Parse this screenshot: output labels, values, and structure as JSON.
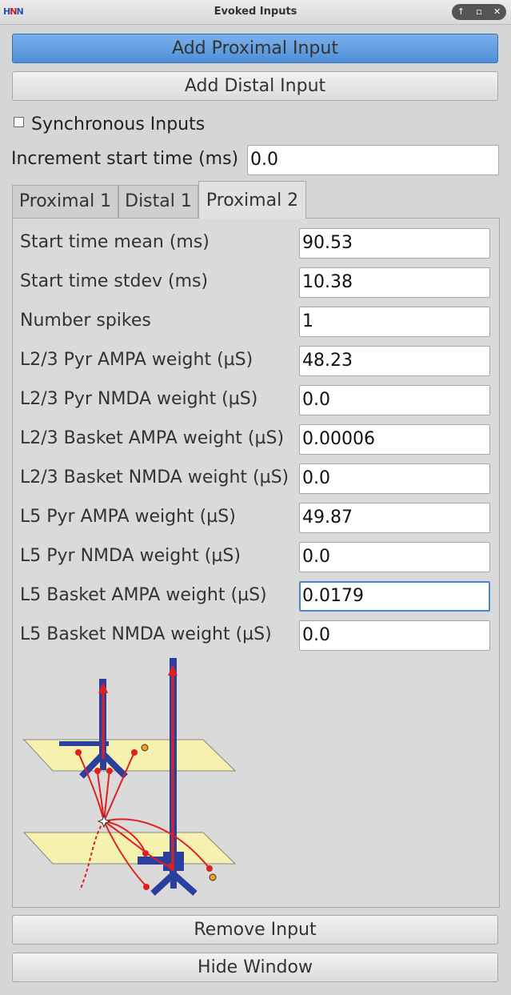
{
  "window": {
    "title": "Evoked Inputs",
    "logo": {
      "h1": "H",
      "n": "N",
      "h2": "N"
    },
    "controls": [
      "↑",
      "▫",
      "✕"
    ]
  },
  "buttons": {
    "add_proximal": "Add Proximal Input",
    "add_distal": "Add Distal Input",
    "remove_input": "Remove Input",
    "hide_window": "Hide Window"
  },
  "synchronous": {
    "label": "Synchronous Inputs",
    "checked": false
  },
  "increment": {
    "label": "Increment start time (ms)",
    "value": "0.0"
  },
  "tabs": [
    {
      "label": "Proximal 1",
      "active": false
    },
    {
      "label": "Distal 1",
      "active": false
    },
    {
      "label": "Proximal 2",
      "active": true
    }
  ],
  "params": [
    {
      "label": "Start time mean (ms)",
      "value": "90.53"
    },
    {
      "label": "Start time stdev (ms)",
      "value": "10.38"
    },
    {
      "label": "Number spikes",
      "value": "1"
    },
    {
      "label": "L2/3 Pyr AMPA weight (µS)",
      "value": "48.23"
    },
    {
      "label": "L2/3 Pyr NMDA weight (µS)",
      "value": "0.0"
    },
    {
      "label": "L2/3 Basket AMPA weight (µS)",
      "value": "0.00006"
    },
    {
      "label": "L2/3 Basket NMDA weight (µS)",
      "value": "0.0"
    },
    {
      "label": "L5 Pyr AMPA weight (µS)",
      "value": "49.87"
    },
    {
      "label": "L5 Pyr NMDA weight (µS)",
      "value": "0.0"
    },
    {
      "label": "L5 Basket AMPA weight (µS)",
      "value": "0.0179"
    },
    {
      "label": "L5 Basket NMDA weight (µS)",
      "value": "0.0"
    }
  ],
  "colors": {
    "accent": "#5a96dc",
    "neuron": "#2a3f9e",
    "input": "#e02020",
    "layer": "#f5f2b0",
    "basket": "#f0a020"
  }
}
